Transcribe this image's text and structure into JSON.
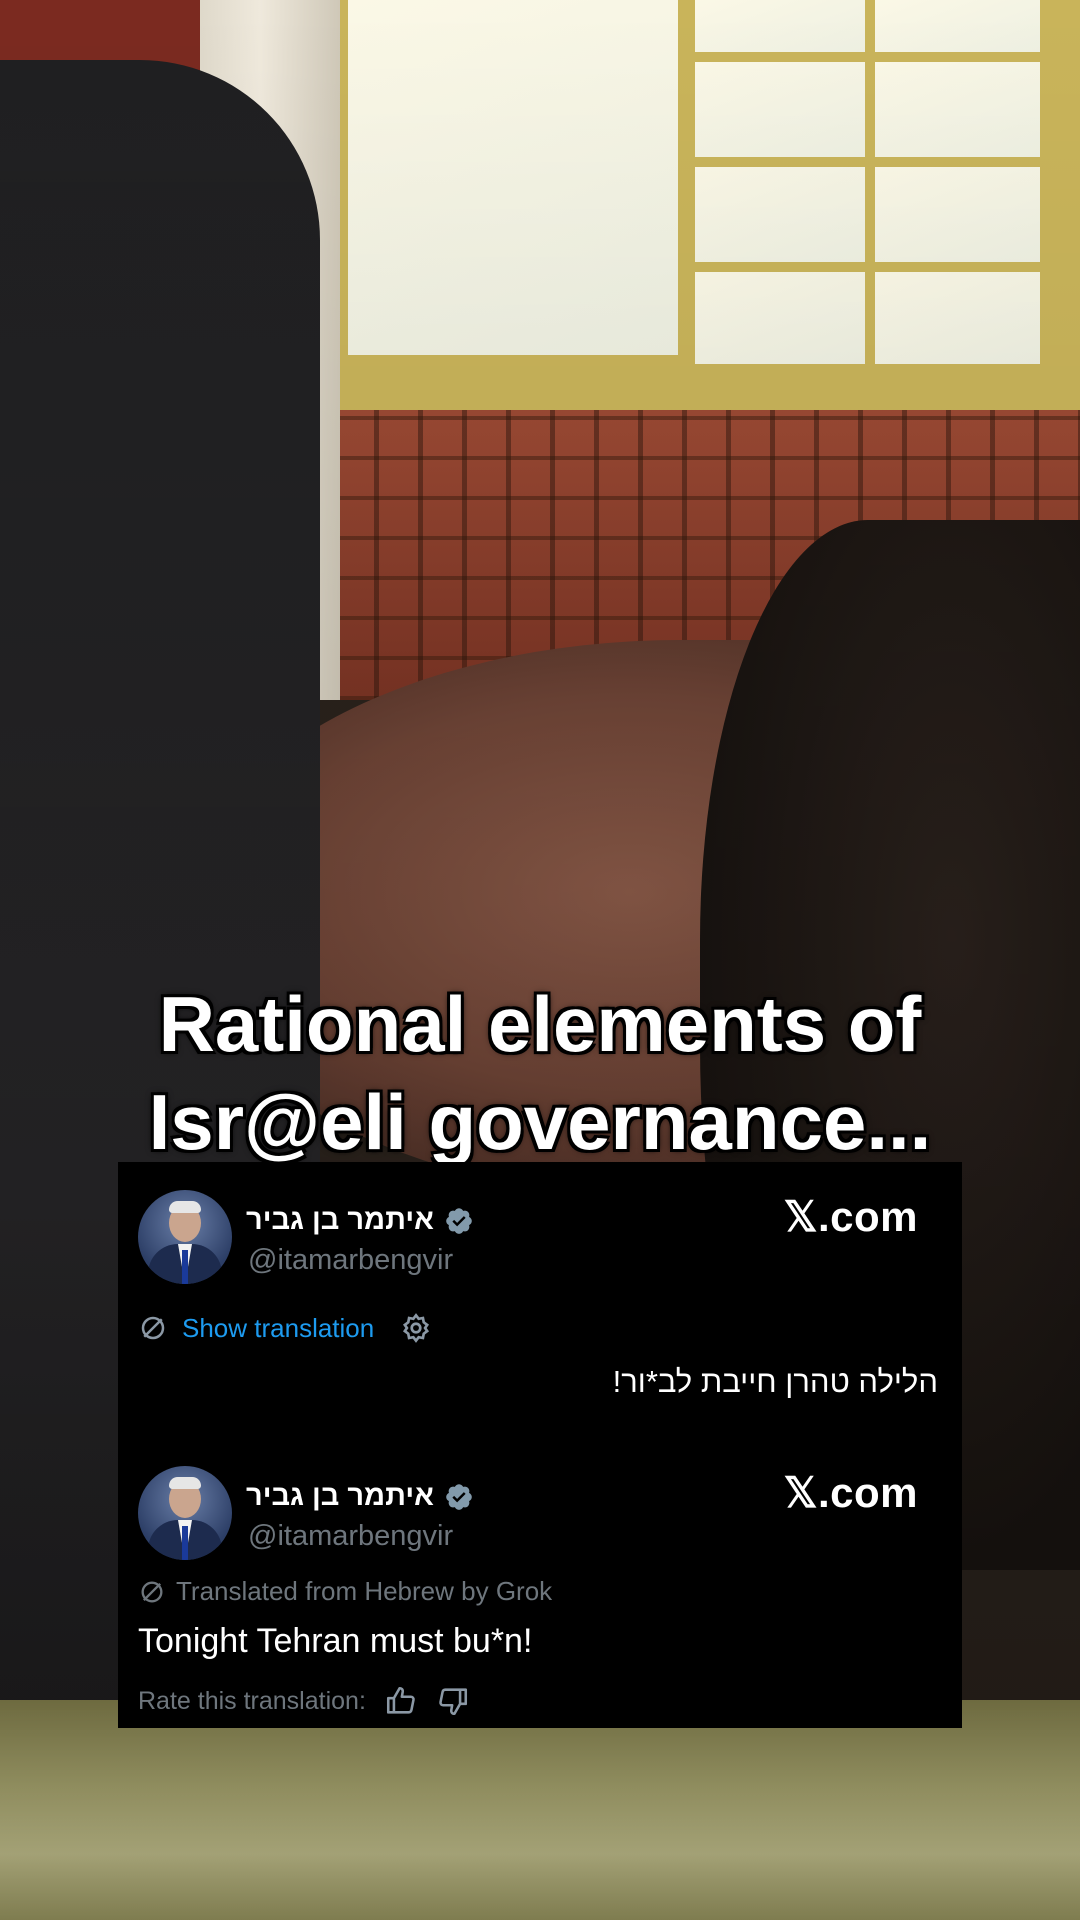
{
  "caption": {
    "line1": "Rational elements of",
    "line2": "Isr@eli governance..."
  },
  "tweet_original": {
    "display_name": "איתמר בן גביר",
    "handle": "@itamarbengvir",
    "site": "𝕏.com",
    "show_translation": "Show translation",
    "text": "הלילה טהרן חייבת לב*ור!",
    "icons": [
      "verified-badge-icon",
      "translate-icon",
      "gear-icon"
    ]
  },
  "tweet_translated": {
    "display_name": "איתמר בן גביר",
    "handle": "@itamarbengvir",
    "site": "𝕏.com",
    "translated_label": "Translated from Hebrew by Grok",
    "text": "Tonight Tehran must bu*n!",
    "rate_label": "Rate this translation:",
    "icons": [
      "verified-badge-icon",
      "translate-icon",
      "thumbs-up-icon",
      "thumbs-down-icon"
    ]
  },
  "colors": {
    "link_blue": "#1d9bf0",
    "muted_gray": "#6e767d",
    "card_bg": "#000000"
  }
}
